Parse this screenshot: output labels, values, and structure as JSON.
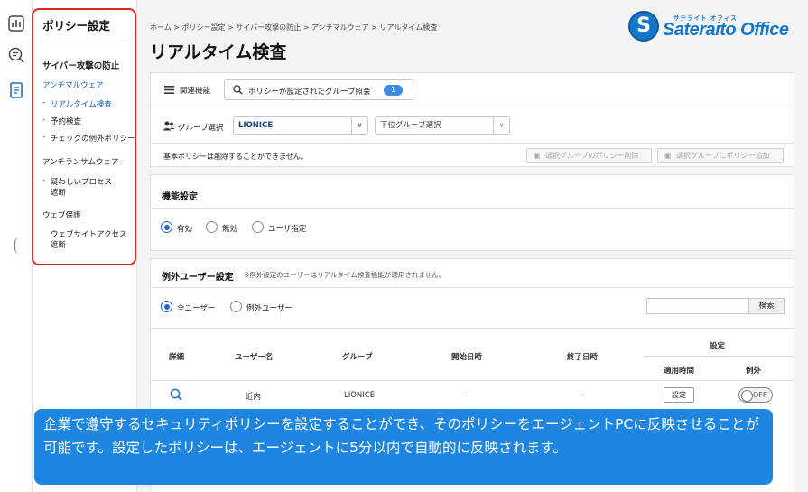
{
  "rail": {
    "icons": [
      "analytics-icon",
      "search-list-icon",
      "policy-book-icon"
    ]
  },
  "sidebar": {
    "title": "ポリシー設定",
    "section1": "サイバー攻撃の防止",
    "group_anti_malware": "アンチマルウェア",
    "item_realtime": "リアルタイム検査",
    "item_scheduled": "予約検査",
    "item_exceptions": "チェックの例外ポリシー",
    "group_anti_ransomware": "アンチランサムウェア",
    "item_suspicious_1": "疑わしいプロセス",
    "item_suspicious_2": "遮断",
    "group_web": "ウェブ保護",
    "item_website_1": "ウェブサイトアクセス",
    "item_website_2": "遮断",
    "dash": "-"
  },
  "breadcrumb": "ホーム > ポリシー設定 > サイバー攻撃の防止 > アンチマルウェア > リアルタイム検査",
  "page_title": "リアルタイム検査",
  "logo": {
    "kana": "サテライト オフィス",
    "name": "Sateraito Office",
    "mark": "S"
  },
  "related": {
    "label": "関連機能",
    "search_text": "ポリシーが設定されたグループ照会",
    "badge": "1"
  },
  "group_select": {
    "label": "グループ選択",
    "value": "LIONICE",
    "sub_placeholder": "下位グループ選択"
  },
  "notice": "基本ポリシーは削除することができません。",
  "buttons": {
    "delete_policy": "選択グループのポリシー削除",
    "add_policy": "選択グループにポリシー追加"
  },
  "feature": {
    "title": "機能設定",
    "options": [
      "有効",
      "無効",
      "ユーザ指定"
    ],
    "selected": "有効"
  },
  "exceptions": {
    "title": "例外ユーザー設定",
    "note": "※例外設定のユーザーはリアルタイム検査機能が適用されません。",
    "options": [
      "全ユーザー",
      "例外ユーザー"
    ],
    "selected": "全ユーザー",
    "search_button": "検索"
  },
  "table": {
    "headers": {
      "detail": "詳細",
      "username": "ユーザー名",
      "group": "グループ",
      "start": "開始日時",
      "end": "終了日時",
      "settings": "設定",
      "apply_time": "適用時間",
      "exception": "例外"
    },
    "rows": [
      {
        "username": "近内",
        "group": "LIONICE",
        "start": "-",
        "end": "-",
        "set_label": "設定",
        "toggle": "OFF"
      }
    ]
  },
  "caption": "企業で遵守するセキュリティポリシーを設定することができ、そのポリシーをエージェントPCに反映させることが可能です。設定したポリシーは、エージェントに5分以内で自動的に反映されます。",
  "colors": {
    "accent": "#1e86e0",
    "highlight": "#e02828",
    "link": "#1a5fb4"
  }
}
